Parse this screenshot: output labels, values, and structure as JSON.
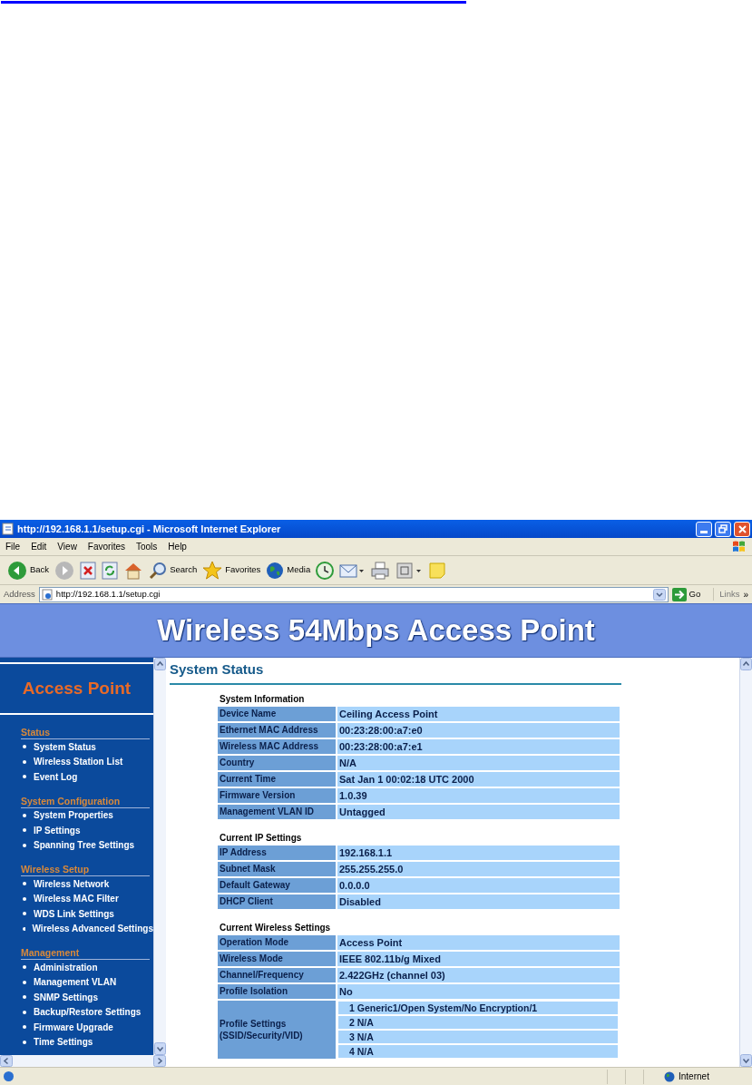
{
  "window": {
    "title": "http://192.168.1.1/setup.cgi - Microsoft Internet Explorer"
  },
  "menu": [
    "File",
    "Edit",
    "View",
    "Favorites",
    "Tools",
    "Help"
  ],
  "toolbar": [
    {
      "kind": "back",
      "label": "Back"
    },
    {
      "kind": "forward"
    },
    {
      "kind": "stop"
    },
    {
      "kind": "refresh"
    },
    {
      "kind": "home"
    },
    {
      "kind": "search",
      "label": "Search"
    },
    {
      "kind": "favorites",
      "label": "Favorites"
    },
    {
      "kind": "media",
      "label": "Media"
    },
    {
      "kind": "history"
    },
    {
      "kind": "mail"
    },
    {
      "kind": "print"
    },
    {
      "kind": "edit"
    },
    {
      "kind": "note"
    }
  ],
  "address": {
    "label": "Address",
    "value": "http://192.168.1.1/setup.cgi",
    "go": "Go",
    "links": "Links",
    "more": "»"
  },
  "banner": {
    "title": "Wireless 54Mbps Access Point"
  },
  "sidebar": {
    "logo": "Access Point",
    "sections": [
      {
        "title": "Status",
        "items": [
          "System Status",
          "Wireless Station List",
          "Event Log"
        ]
      },
      {
        "title": "System Configuration",
        "items": [
          "System Properties",
          "IP Settings",
          "Spanning Tree Settings"
        ]
      },
      {
        "title": "Wireless Setup",
        "items": [
          "Wireless Network",
          "Wireless MAC Filter",
          "WDS Link Settings",
          "Wireless Advanced Settings"
        ]
      },
      {
        "title": "Management",
        "items": [
          "Administration",
          "Management VLAN",
          "SNMP Settings",
          "Backup/Restore Settings",
          "Firmware Upgrade",
          "Time Settings"
        ]
      }
    ]
  },
  "main": {
    "title": "System Status",
    "sections": [
      {
        "title": "System Information",
        "rows": [
          {
            "label": "Device Name",
            "value": "Ceiling Access Point"
          },
          {
            "label": "Ethernet MAC Address",
            "value": "00:23:28:00:a7:e0"
          },
          {
            "label": "Wireless MAC Address",
            "value": "00:23:28:00:a7:e1"
          },
          {
            "label": "Country",
            "value": "N/A"
          },
          {
            "label": "Current Time",
            "value": "Sat Jan 1 00:02:18 UTC 2000"
          },
          {
            "label": "Firmware Version",
            "value": "1.0.39"
          },
          {
            "label": "Management VLAN ID",
            "value": "Untagged"
          }
        ]
      },
      {
        "title": "Current IP Settings",
        "rows": [
          {
            "label": "IP Address",
            "value": "192.168.1.1"
          },
          {
            "label": "Subnet Mask",
            "value": "255.255.255.0"
          },
          {
            "label": "Default Gateway",
            "value": "0.0.0.0"
          },
          {
            "label": "DHCP Client",
            "value": "Disabled"
          }
        ]
      },
      {
        "title": "Current Wireless Settings",
        "rows": [
          {
            "label": "Operation Mode",
            "value": "Access Point"
          },
          {
            "label": "Wireless Mode",
            "value": "IEEE 802.11b/g Mixed"
          },
          {
            "label": "Channel/Frequency",
            "value": "2.422GHz (channel 03)"
          },
          {
            "label": "Profile Isolation",
            "value": "No"
          },
          {
            "label": "Profile Settings (SSID/Security/VID)",
            "values": [
              "1 Generic1/Open System/No Encryption/1",
              "2 N/A",
              "3 N/A",
              "4 N/A"
            ]
          }
        ]
      }
    ]
  },
  "status_bar": {
    "zone": "Internet"
  }
}
